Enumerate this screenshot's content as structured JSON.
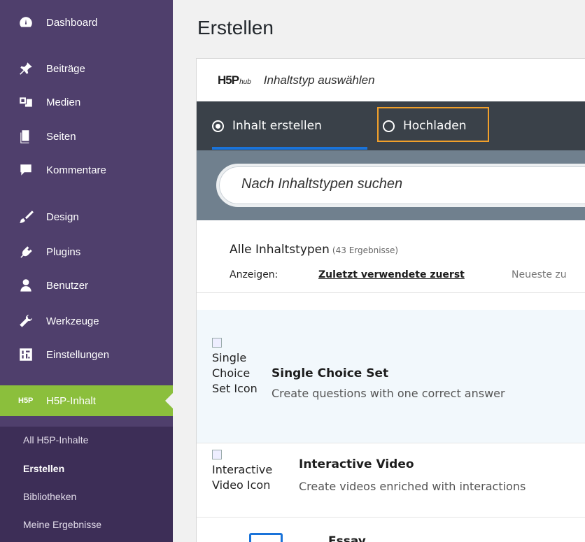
{
  "sidebar": {
    "items": [
      {
        "label": "Dashboard",
        "icon": "dashboard-icon"
      },
      {
        "label": "Beiträge",
        "icon": "pin-icon"
      },
      {
        "label": "Medien",
        "icon": "media-icon"
      },
      {
        "label": "Seiten",
        "icon": "pages-icon"
      },
      {
        "label": "Kommentare",
        "icon": "comment-icon"
      },
      {
        "label": "Design",
        "icon": "brush-icon"
      },
      {
        "label": "Plugins",
        "icon": "plugin-icon"
      },
      {
        "label": "Benutzer",
        "icon": "user-icon"
      },
      {
        "label": "Werkzeuge",
        "icon": "wrench-icon"
      },
      {
        "label": "Einstellungen",
        "icon": "settings-icon"
      },
      {
        "label": "H5P-Inhalt",
        "icon": "h5p-icon",
        "icon_text": "H5P",
        "active": true
      }
    ],
    "submenu": [
      {
        "label": "All H5P-Inhalte"
      },
      {
        "label": "Erstellen",
        "current": true
      },
      {
        "label": "Bibliotheken"
      },
      {
        "label": "Meine Ergebnisse"
      }
    ]
  },
  "page": {
    "title": "Erstellen"
  },
  "hub": {
    "logo": {
      "h5p": "H5P",
      "hub": "hub"
    },
    "title": "Inhaltstyp auswählen",
    "tabs": [
      {
        "label": "Inhalt erstellen",
        "selected": true
      },
      {
        "label": "Hochladen",
        "selected": false
      }
    ],
    "search": {
      "placeholder": "Nach Inhaltstypen suchen"
    },
    "list": {
      "heading": "Alle Inhaltstypen",
      "count": "(43 Ergebnisse)",
      "sort_label": "Anzeigen:",
      "sort_options": [
        "Zuletzt verwendete zuerst",
        "Neueste zu"
      ]
    },
    "content_types": [
      {
        "icon_alt": "Single Choice Set Icon",
        "title": "Single Choice Set",
        "description": "Create questions with one correct answer"
      },
      {
        "icon_alt": "Interactive Video Icon",
        "title": "Interactive Video",
        "description": "Create videos enriched with interactions"
      },
      {
        "icon_alt": "",
        "title": "Essay",
        "description": ""
      }
    ]
  },
  "colors": {
    "sidebar_bg": "#4f3f6c",
    "active_menu": "#8bbf3c",
    "tab_bar": "#3a4149",
    "tab_underline": "#1a73d9",
    "upload_highlight": "#f2a02a",
    "search_band": "#70808e"
  }
}
